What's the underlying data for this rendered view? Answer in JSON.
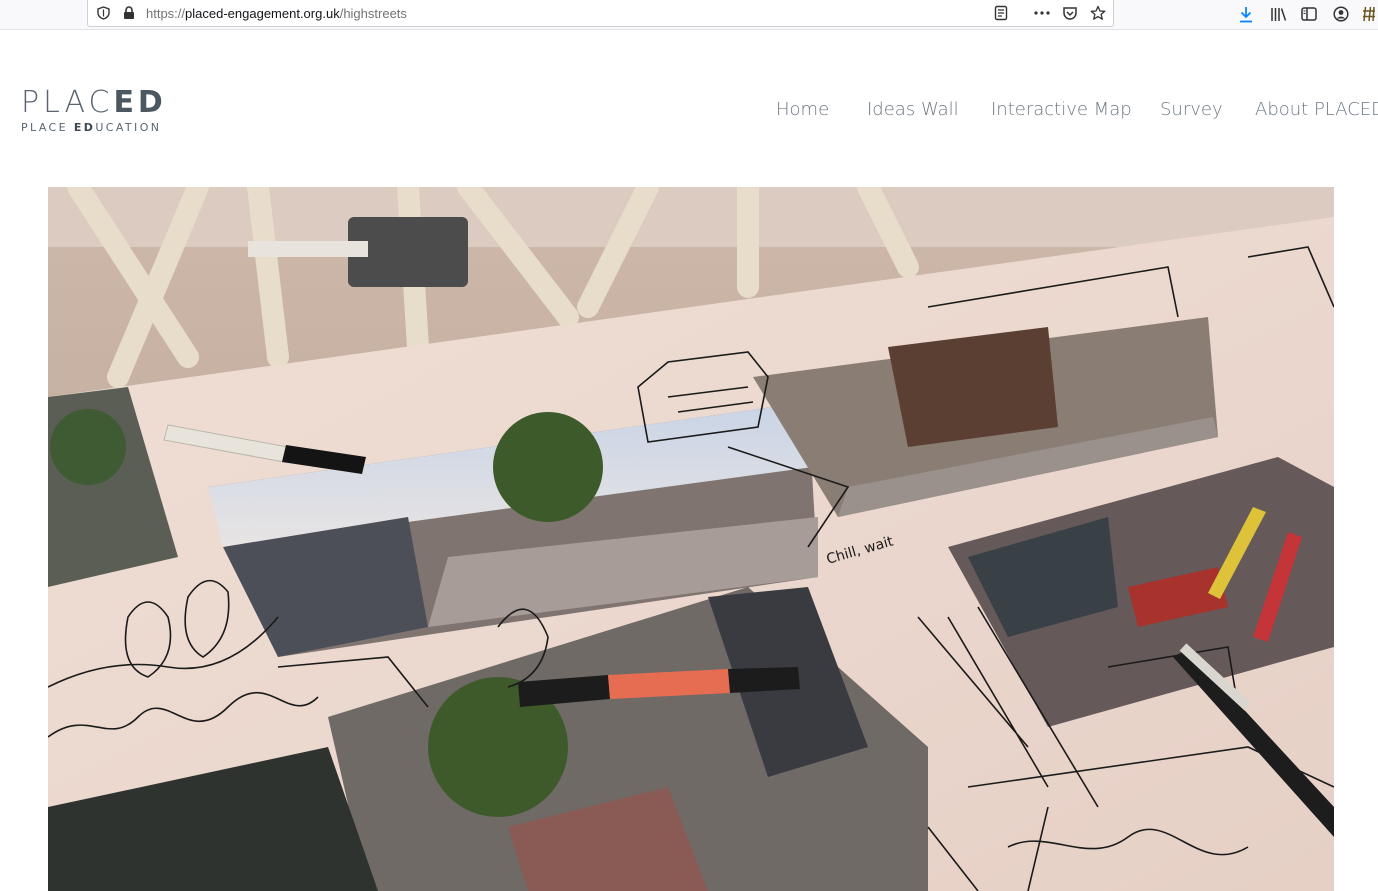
{
  "browser": {
    "url_prefix": "https://",
    "url_domain": "placed-engagement.org.uk",
    "url_path": "/highstreets",
    "icons": [
      "shield-icon",
      "lock-icon",
      "reader-view-icon",
      "more-icon",
      "pocket-icon",
      "bookmark-star-icon",
      "download-icon",
      "library-icon",
      "sidebar-icon",
      "account-icon",
      "extension-icon"
    ]
  },
  "site": {
    "logo_main_light": "PLAC",
    "logo_main_bold": "ED",
    "logo_sub_pre": "PLACE ",
    "logo_sub_bold": "ED",
    "logo_sub_post": "UCATION",
    "nav": [
      "Home",
      "Ideas Wall",
      "Interactive Map",
      "Survey",
      "About PLACED"
    ]
  },
  "hero": {
    "handwriting": "Chill, wait"
  },
  "colors": {
    "nav_text": "#6d7882",
    "logo": "#5a6570",
    "download_accent": "#0a84ff"
  }
}
